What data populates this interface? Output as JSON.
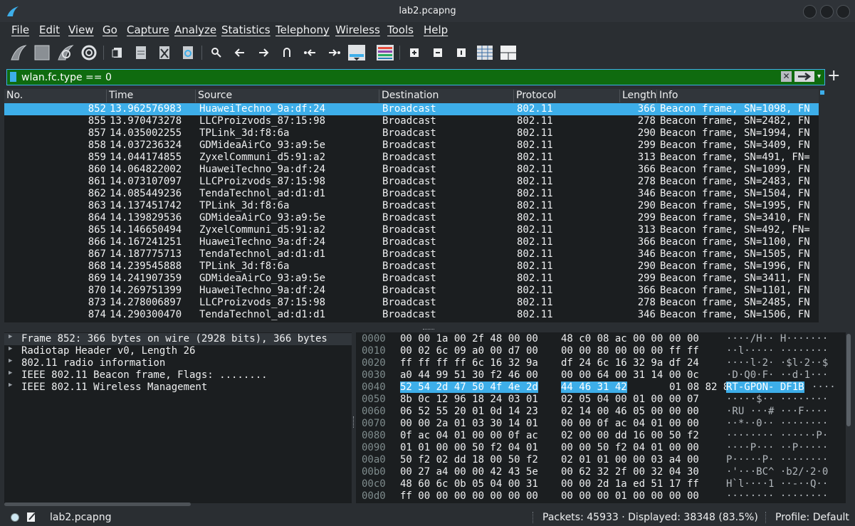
{
  "window": {
    "title": "lab2.pcapng"
  },
  "menu": [
    "File",
    "Edit",
    "View",
    "Go",
    "Capture",
    "Analyze",
    "Statistics",
    "Telephony",
    "Wireless",
    "Tools",
    "Help"
  ],
  "toolbar": {
    "icons": [
      "start-capture-icon",
      "stop-capture-icon",
      "restart-capture-icon",
      "capture-options-icon",
      "open-file-icon",
      "save-file-icon",
      "close-file-icon",
      "reload-file-icon",
      "find-packet-icon",
      "go-back-icon",
      "go-forward-icon",
      "go-to-packet-icon",
      "first-packet-icon",
      "last-packet-icon",
      "autoscroll-icon",
      "colorize-icon",
      "zoom-in-icon",
      "zoom-out-icon",
      "normal-size-icon",
      "resize-columns-icon",
      "layout-icon"
    ]
  },
  "filter": {
    "value": "wlan.fc.type == 0",
    "plus": "+",
    "clear": "✕"
  },
  "packet_list": {
    "columns": [
      "No.",
      "Time",
      "Source",
      "Destination",
      "Protocol",
      "Length",
      "Info"
    ],
    "rows": [
      {
        "no": "852",
        "time": "13.962576983",
        "src": "HuaweiTechno_9a:df:24",
        "dst": "Broadcast",
        "proto": "802.11",
        "len": "366",
        "info": "Beacon frame, SN=1098, FN"
      },
      {
        "no": "855",
        "time": "13.970473278",
        "src": "LLCProizvods_87:15:98",
        "dst": "Broadcast",
        "proto": "802.11",
        "len": "278",
        "info": "Beacon frame, SN=2482, FN"
      },
      {
        "no": "857",
        "time": "14.035002255",
        "src": "TPLink_3d:f8:6a",
        "dst": "Broadcast",
        "proto": "802.11",
        "len": "290",
        "info": "Beacon frame, SN=1994, FN"
      },
      {
        "no": "858",
        "time": "14.037236324",
        "src": "GDMideaAirCo_93:a9:5e",
        "dst": "Broadcast",
        "proto": "802.11",
        "len": "299",
        "info": "Beacon frame, SN=3409, FN"
      },
      {
        "no": "859",
        "time": "14.044174855",
        "src": "ZyxelCommuni_d5:91:a2",
        "dst": "Broadcast",
        "proto": "802.11",
        "len": "313",
        "info": "Beacon frame, SN=491, FN="
      },
      {
        "no": "860",
        "time": "14.064822002",
        "src": "HuaweiTechno_9a:df:24",
        "dst": "Broadcast",
        "proto": "802.11",
        "len": "366",
        "info": "Beacon frame, SN=1099, FN"
      },
      {
        "no": "861",
        "time": "14.073107097",
        "src": "LLCProizvods_87:15:98",
        "dst": "Broadcast",
        "proto": "802.11",
        "len": "278",
        "info": "Beacon frame, SN=2483, FN"
      },
      {
        "no": "862",
        "time": "14.085449236",
        "src": "TendaTechnol_ad:d1:d1",
        "dst": "Broadcast",
        "proto": "802.11",
        "len": "346",
        "info": "Beacon frame, SN=1504, FN"
      },
      {
        "no": "863",
        "time": "14.137451742",
        "src": "TPLink_3d:f8:6a",
        "dst": "Broadcast",
        "proto": "802.11",
        "len": "290",
        "info": "Beacon frame, SN=1995, FN"
      },
      {
        "no": "864",
        "time": "14.139829536",
        "src": "GDMideaAirCo_93:a9:5e",
        "dst": "Broadcast",
        "proto": "802.11",
        "len": "299",
        "info": "Beacon frame, SN=3410, FN"
      },
      {
        "no": "865",
        "time": "14.146650494",
        "src": "ZyxelCommuni_d5:91:a2",
        "dst": "Broadcast",
        "proto": "802.11",
        "len": "313",
        "info": "Beacon frame, SN=492, FN="
      },
      {
        "no": "866",
        "time": "14.167241251",
        "src": "HuaweiTechno_9a:df:24",
        "dst": "Broadcast",
        "proto": "802.11",
        "len": "366",
        "info": "Beacon frame, SN=1100, FN"
      },
      {
        "no": "867",
        "time": "14.187775713",
        "src": "TendaTechnol_ad:d1:d1",
        "dst": "Broadcast",
        "proto": "802.11",
        "len": "346",
        "info": "Beacon frame, SN=1505, FN"
      },
      {
        "no": "868",
        "time": "14.239545888",
        "src": "TPLink_3d:f8:6a",
        "dst": "Broadcast",
        "proto": "802.11",
        "len": "290",
        "info": "Beacon frame, SN=1996, FN"
      },
      {
        "no": "869",
        "time": "14.241907359",
        "src": "GDMideaAirCo_93:a9:5e",
        "dst": "Broadcast",
        "proto": "802.11",
        "len": "299",
        "info": "Beacon frame, SN=3411, FN"
      },
      {
        "no": "870",
        "time": "14.269751399",
        "src": "HuaweiTechno_9a:df:24",
        "dst": "Broadcast",
        "proto": "802.11",
        "len": "366",
        "info": "Beacon frame, SN=1101, FN"
      },
      {
        "no": "873",
        "time": "14.278006897",
        "src": "LLCProizvods_87:15:98",
        "dst": "Broadcast",
        "proto": "802.11",
        "len": "278",
        "info": "Beacon frame, SN=2485, FN"
      },
      {
        "no": "874",
        "time": "14.290300470",
        "src": "TendaTechnol_ad:d1:d1",
        "dst": "Broadcast",
        "proto": "802.11",
        "len": "346",
        "info": "Beacon frame, SN=1506, FN"
      }
    ]
  },
  "details": [
    "Frame 852: 366 bytes on wire (2928 bits), 366 bytes",
    "Radiotap Header v0, Length 26",
    "802.11 radio information",
    "IEEE 802.11 Beacon frame, Flags: ........",
    "IEEE 802.11 Wireless Management"
  ],
  "bytes": [
    {
      "off": "0000",
      "a": "00 00 1a 00 2f 48 00 00",
      "b": "48 c0 08 ac 00 00 00 00",
      "ascii": "····/H·· H·······"
    },
    {
      "off": "0010",
      "a": "00 02 6c 09 a0 00 d7 00",
      "b": "00 00 80 00 00 00 ff ff",
      "ascii": "··l····· ········"
    },
    {
      "off": "0020",
      "a": "ff ff ff ff 6c 16 32 9a",
      "b": "df 24 6c 16 32 9a df 24",
      "ascii": "····l·2· ·$l·2··$"
    },
    {
      "off": "0030",
      "a": "a0 44 99 51 30 f2 46 00",
      "b": "00 00 64 00 31 14 00 0c",
      "ascii": "·D·Q0·F· ··d·1···"
    },
    {
      "off": "0040",
      "a": "52 54 2d 47 50 4f 4e 2d",
      "b": "44 46 31 42",
      "b2": "01 08 82 84",
      "ascii": "RT-GPON- DF1B",
      "ascii2": "····"
    },
    {
      "off": "0050",
      "a": "8b 0c 12 96 18 24 03 01",
      "b": "02 05 04 00 01 00 00 07",
      "ascii": "·····$·· ········"
    },
    {
      "off": "0060",
      "a": "06 52 55 20 01 0d 14 23",
      "b": "02 14 00 46 05 00 00 00",
      "ascii": "·RU ···# ···F····"
    },
    {
      "off": "0070",
      "a": "00 00 2a 01 03 30 14 01",
      "b": "00 00 0f ac 04 01 00 00",
      "ascii": "··*··0·· ········"
    },
    {
      "off": "0080",
      "a": "0f ac 04 01 00 00 0f ac",
      "b": "02 00 00 dd 16 00 50 f2",
      "ascii": "········ ······P·"
    },
    {
      "off": "0090",
      "a": "01 01 00 00 50 f2 04 01",
      "b": "00 00 50 f2 04 01 00 00",
      "ascii": "····P··· ··P·····"
    },
    {
      "off": "00a0",
      "a": "50 f2 02 dd 18 00 50 f2",
      "b": "02 01 01 00 00 03 a4 00",
      "ascii": "P·····P· ········"
    },
    {
      "off": "00b0",
      "a": "00 27 a4 00 00 42 43 5e",
      "b": "00 62 32 2f 00 32 04 30",
      "ascii": "·'···BC^ ·b2/·2·0"
    },
    {
      "off": "00c0",
      "a": "48 60 6c 0b 05 04 00 31",
      "b": "00 00 2d 1a ed 51 17 ff",
      "ascii": "H`l····1 ··-··Q··"
    },
    {
      "off": "00d0",
      "a": "ff 00 00 00 00 00 00 00",
      "b": "00 00 00 01 00 00 00 00",
      "ascii": "········ ········"
    }
  ],
  "status": {
    "file": "lab2.pcapng",
    "packets": "Packets: 45933 · Displayed: 38348 (83.5%)",
    "profile": "Profile: Default"
  },
  "colors": {
    "selection": "#3daee9",
    "filter_valid": "#0f6b0f",
    "background": "#1b1e20"
  }
}
